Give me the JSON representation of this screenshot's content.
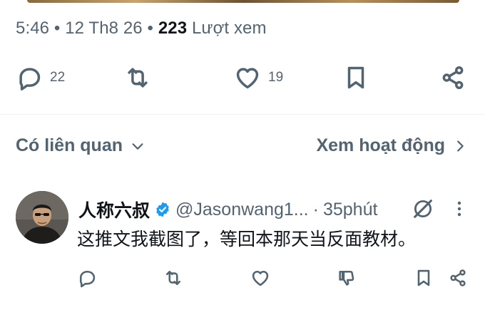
{
  "post_meta": {
    "time": "5:46",
    "date": "12 Th8 26",
    "sep": "•",
    "views_count": "223",
    "views_label": "Lượt xem"
  },
  "post_actions": {
    "replies": "22",
    "likes": "19"
  },
  "related": {
    "title": "Có liên quan",
    "see_activity": "Xem hoạt động"
  },
  "reply_tweet": {
    "display_name": "人称六叔",
    "handle": "@Jasonwang1...",
    "sep": "·",
    "time": "35phút",
    "text": "这推文我截图了，等回本那天当反面教材。"
  },
  "colors": {
    "text_primary": "#0f1419",
    "text_secondary": "#536471",
    "verified_blue": "#1d9bf0",
    "divider": "#eff3f4"
  }
}
